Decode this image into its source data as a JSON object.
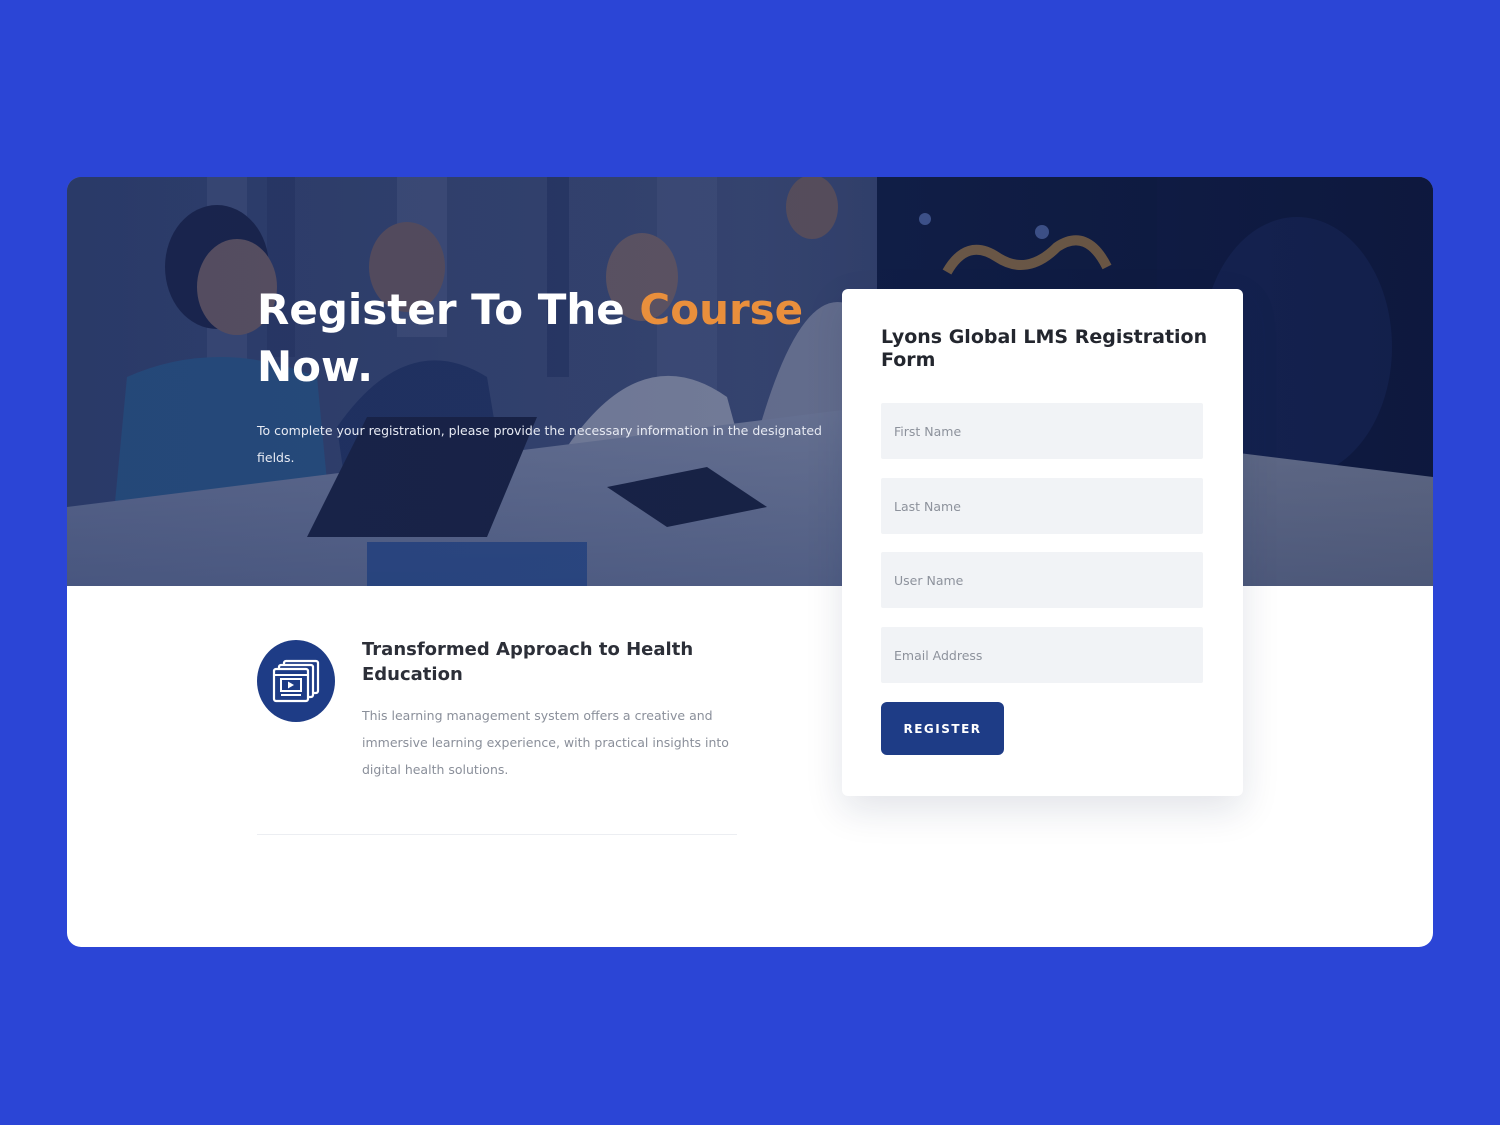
{
  "hero": {
    "title_part1": "Register To The ",
    "title_accent": "Course",
    "title_part2": " Now.",
    "subtitle": "To complete your registration, please provide the necessary information in the designated fields."
  },
  "feature": {
    "icon": "video-course-icon",
    "title": "Transformed Approach to Health Education",
    "description": "This learning management system offers a creative and immersive learning experience, with practical insights into digital health solutions."
  },
  "form": {
    "title": "Lyons Global LMS Registration Form",
    "fields": [
      {
        "placeholder": "First Name",
        "value": ""
      },
      {
        "placeholder": "Last Name",
        "value": ""
      },
      {
        "placeholder": "User Name",
        "value": ""
      },
      {
        "placeholder": "Email Address",
        "value": ""
      }
    ],
    "submit_label": "REGISTER"
  },
  "colors": {
    "page_background": "#2b45d6",
    "accent_orange": "#e98f3c",
    "brand_navy": "#1e3c86",
    "input_background": "#f1f3f6"
  }
}
